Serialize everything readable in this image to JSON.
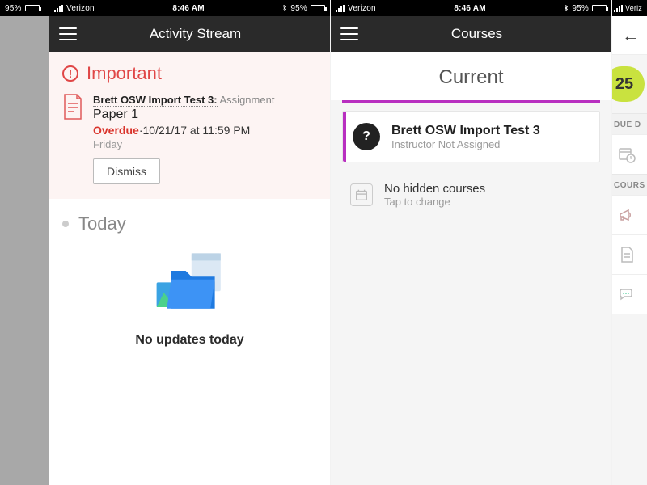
{
  "status": {
    "carrier": "Verizon",
    "time": "8:46 AM",
    "battery_percent": "95%",
    "carrier_short": "Veriz"
  },
  "stream": {
    "nav_title": "Activity Stream",
    "important_label": "Important",
    "assignment": {
      "course": "Brett OSW Import Test 3:",
      "type": "Assignment",
      "title": "Paper 1",
      "status_label": "Overdue",
      "status_sep": "·",
      "due_text": "10/21/17 at 11:59 PM",
      "day": "Friday",
      "dismiss": "Dismiss"
    },
    "today_label": "Today",
    "no_updates": "No updates today"
  },
  "courses": {
    "nav_title": "Courses",
    "current_label": "Current",
    "card": {
      "avatar": "?",
      "title": "Brett OSW Import Test 3",
      "subtitle": "Instructor Not Assigned"
    },
    "hidden": {
      "title": "No hidden courses",
      "subtitle": "Tap to change"
    }
  },
  "detail": {
    "grade": "25",
    "due_label": "DUE D",
    "course_label": "COURS"
  }
}
